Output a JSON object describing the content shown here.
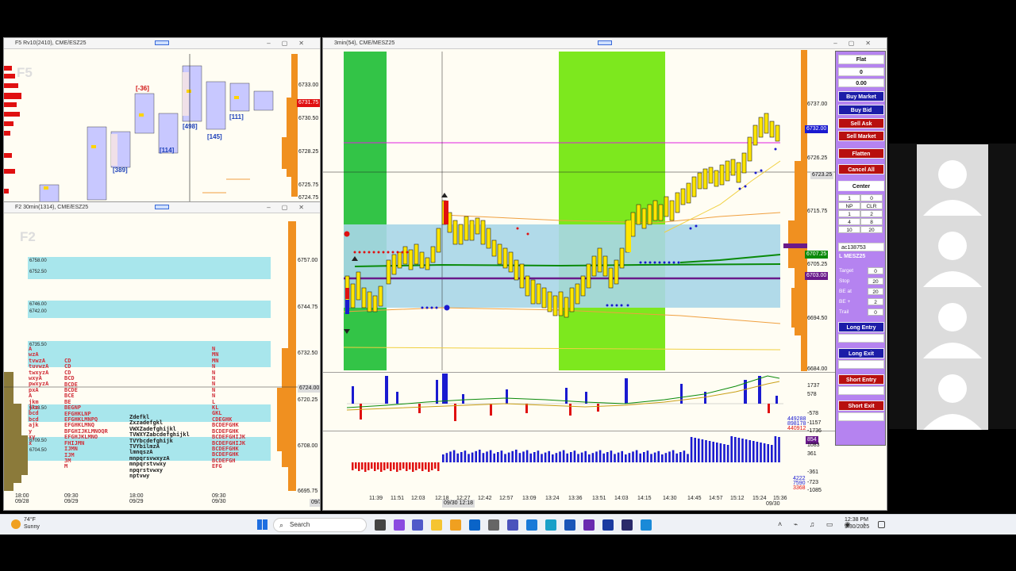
{
  "f5": {
    "title": "F5 Rv10(2410), CME/ESZ25",
    "label": "F5",
    "prices": [
      "6733.00",
      "6730.50",
      "6728.25",
      "6725.75",
      "6724.75"
    ],
    "current_price": "6731.75",
    "deltas": [
      "[-36]",
      "[498]",
      "[111]",
      "[389]",
      "[114]",
      "[145]"
    ]
  },
  "f2": {
    "title": "F2 30min(1314), CME/ESZ25",
    "label": "F2",
    "levels": [
      "6758.00",
      "6752.50",
      "6746.00",
      "6742.00",
      "6735.50",
      "6713.50",
      "6709.50",
      "6704.50"
    ],
    "prices": [
      "6757.00",
      "6744.75",
      "6732.50",
      "6720.25",
      "6708.00",
      "6695.75"
    ],
    "current_price": "6724.00",
    "times": [
      "18:00",
      "09:30",
      "18:00",
      "09:30"
    ],
    "dates": [
      "09/28",
      "09/29",
      "09/29",
      "09/30"
    ],
    "date_box": "09/30"
  },
  "main": {
    "title": "3min(54), CME/MESZ25",
    "prices": [
      "6737.00",
      "6726.25",
      "6715.75",
      "6705.25",
      "6694.50",
      "6684.00"
    ],
    "tags": {
      "current": "6732.00",
      "crosshair": "6723.25",
      "green": "6707.25",
      "purple": "6703.00"
    },
    "indicator1": [
      "1737",
      "578",
      "-578",
      "-1157",
      "-1736"
    ],
    "indicator1_vals": [
      "449288",
      "898178",
      "440912"
    ],
    "indicator2": [
      "1083",
      "361",
      "-361",
      "-723",
      "-1085"
    ],
    "indicator2_vals": [
      "4222",
      "7590",
      "3368"
    ],
    "indicator2_tag": "854",
    "times": [
      "11:39",
      "11:51",
      "12:03",
      "12:18",
      "12:27",
      "12:42",
      "12:57",
      "13:09",
      "13:24",
      "13:36",
      "13:51",
      "14:03",
      "14:15",
      "14:30",
      "14:45",
      "14:57",
      "15:12",
      "15:24",
      "15:36"
    ],
    "date_box": "09/30 12:18",
    "last_date": "09/30"
  },
  "order_panel": {
    "status": "Flat",
    "qty": "0",
    "pnl": "0.00",
    "buy_market": "Buy Market",
    "buy_bid": "Buy Bid",
    "sell_ask": "Sell Ask",
    "sell_market": "Sell Market",
    "flatten": "Flatten",
    "cancel_all": "Cancel All",
    "center": "Center",
    "qty_in": "1",
    "qty_out": "0",
    "grid": [
      "NP",
      "CLR",
      "1",
      "2",
      "4",
      "8",
      "10",
      "20"
    ],
    "account": "ac138753",
    "symbol": "L MESZ25",
    "target_label": "Target",
    "target": "0",
    "stop_label": "Stop",
    "stop": "20",
    "beat_label": "BE at",
    "beat": "20",
    "beplus_label": "BE +",
    "beplus": "2",
    "trail_label": "Trail",
    "trail": "0",
    "long_entry": "Long Entry",
    "long_exit": "Long Exit",
    "short_entry": "Short Entry",
    "short_exit": "Short Exit"
  },
  "taskbar": {
    "temp": "74°F",
    "weather": "Sunny",
    "search": "Search",
    "time": "12:38 PM",
    "date": "9/30/2025"
  },
  "colors": {
    "green_zone": "#33c447",
    "lime_zone": "#7de81e",
    "value_area": "#a8d6e8",
    "buy": "#1a1ad0",
    "sell": "#e01010"
  }
}
